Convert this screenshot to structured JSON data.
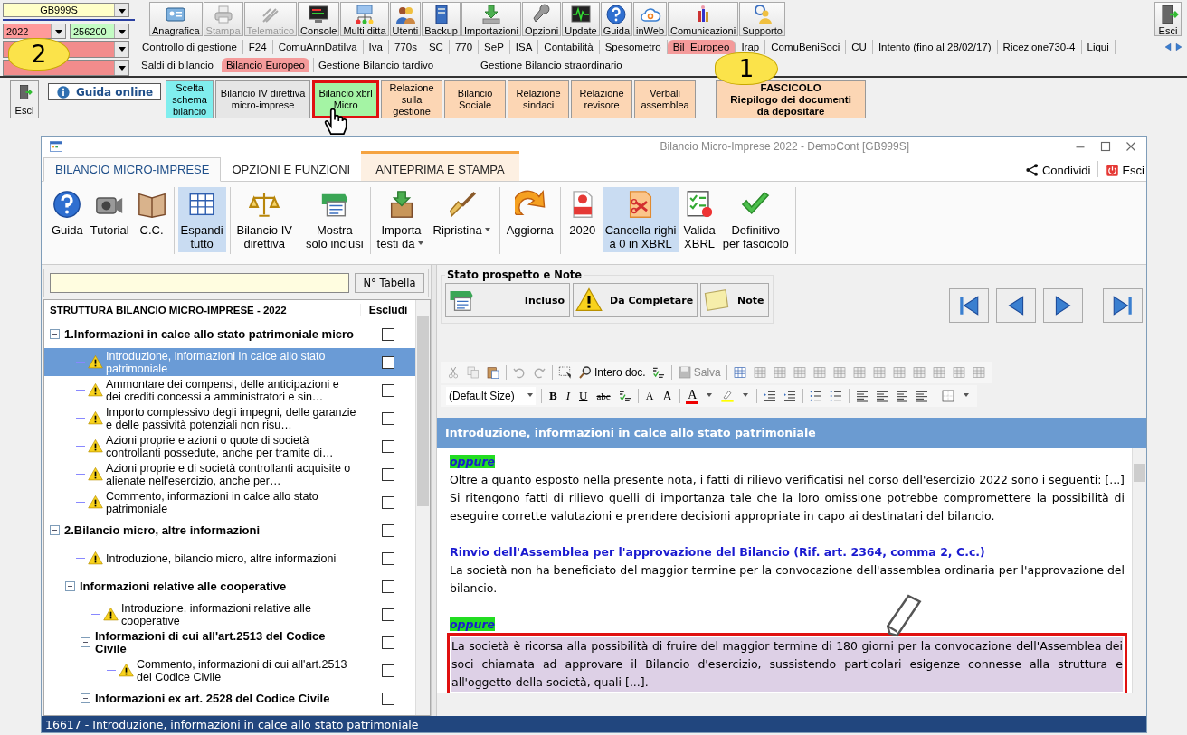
{
  "selectors": {
    "company": "GB999S",
    "year": "2022",
    "code": "256200 -"
  },
  "callouts": [
    {
      "label": "2"
    },
    {
      "label": "1"
    }
  ],
  "toolbar": [
    {
      "label": "Anagrafica",
      "disabled": false
    },
    {
      "label": "Stampa",
      "disabled": true
    },
    {
      "label": "Telematico",
      "disabled": true
    },
    {
      "label": "Console",
      "disabled": false
    },
    {
      "label": "Multi ditta",
      "disabled": false
    },
    {
      "label": "Utenti",
      "disabled": false
    },
    {
      "label": "Backup",
      "disabled": false
    },
    {
      "label": "Importazioni",
      "disabled": false
    },
    {
      "label": "Opzioni",
      "disabled": false
    },
    {
      "label": "Update",
      "disabled": false
    },
    {
      "label": "Guida",
      "disabled": false
    },
    {
      "label": "inWeb",
      "disabled": false
    },
    {
      "label": "Comunicazioni",
      "disabled": false
    },
    {
      "label": "Supporto",
      "disabled": false
    }
  ],
  "exit_button": "Esci",
  "module_tabs": [
    {
      "label": "Controllo di gestione",
      "selected": false
    },
    {
      "label": "F24",
      "selected": false
    },
    {
      "label": "ComuAnnDatiIva",
      "selected": false
    },
    {
      "label": "Iva",
      "selected": false
    },
    {
      "label": "770s",
      "selected": false
    },
    {
      "label": "SC",
      "selected": false
    },
    {
      "label": "770",
      "selected": false
    },
    {
      "label": "SeP",
      "selected": false
    },
    {
      "label": "ISA",
      "selected": false
    },
    {
      "label": "Contabilità",
      "selected": false
    },
    {
      "label": "Spesometro",
      "selected": false
    },
    {
      "label": "Bil_Europeo",
      "selected": true
    },
    {
      "label": "Irap",
      "selected": false
    },
    {
      "label": "ComuBeniSoci",
      "selected": false
    },
    {
      "label": "CU",
      "selected": false
    },
    {
      "label": "Intento (fino al 28/02/17)",
      "selected": false
    },
    {
      "label": "Ricezione730-4",
      "selected": false
    },
    {
      "label": "Liqui",
      "selected": false
    }
  ],
  "sub_tabs": [
    {
      "label": "Saldi di bilancio",
      "selected": false
    },
    {
      "label": "Bilancio Europeo",
      "selected": true
    },
    {
      "label": "Gestione Bilancio tardivo",
      "selected": false
    },
    {
      "label": "Gestione Bilancio straordinario",
      "selected": false
    }
  ],
  "launcher": {
    "exit": "Esci",
    "guide": "Guida online",
    "buttons": [
      {
        "label": "Scelta\nschema\nbilancio",
        "color": "#80eeee",
        "highlighted": false
      },
      {
        "label": "Bilancio IV direttiva\nmicro-imprese",
        "color": "#e6e6e6",
        "highlighted": false
      },
      {
        "label": "Bilancio xbrl\nMicro",
        "color": "#a4f4a4",
        "highlighted": true
      },
      {
        "label": "Relazione\nsulla\ngestione",
        "color": "#fcd6b4",
        "highlighted": false
      },
      {
        "label": "Bilancio\nSociale",
        "color": "#fcd6b4",
        "highlighted": false
      },
      {
        "label": "Relazione\nsindaci",
        "color": "#fcd6b4",
        "highlighted": false
      },
      {
        "label": "Relazione\nrevisore",
        "color": "#fcd6b4",
        "highlighted": false
      },
      {
        "label": "Verbali\nassemblea",
        "color": "#fcd6b4",
        "highlighted": false
      },
      {
        "label": "FASCICOLO\nRiepilogo dei documenti\nda depositare",
        "color": "#fcd6b4",
        "highlighted": false
      }
    ]
  },
  "window": {
    "title": "Bilancio Micro-Imprese 2022 - DemoCont [GB999S]",
    "tabs": [
      {
        "label": "BILANCIO MICRO-IMPRESE",
        "selected": true,
        "kind": "normal"
      },
      {
        "label": "OPZIONI E FUNZIONI",
        "selected": false,
        "kind": "normal"
      },
      {
        "label": "ANTEPRIMA E STAMPA",
        "selected": false,
        "kind": "contextual"
      }
    ],
    "share": "Condividi",
    "exit": "Esci",
    "ribbon": [
      [
        {
          "label": "Guida",
          "active": false
        },
        {
          "label": "Tutorial",
          "active": false
        },
        {
          "label": "C.C.",
          "active": false
        }
      ],
      [
        {
          "label": "Espandi\ntutto",
          "active": true
        }
      ],
      [
        {
          "label": "Bilancio IV\ndirettiva",
          "active": false
        }
      ],
      [
        {
          "label": "Mostra\nsolo inclusi",
          "active": false
        }
      ],
      [
        {
          "label": "Importa\ntesti da",
          "active": false,
          "dropdown": true
        },
        {
          "label": "Ripristina",
          "active": false,
          "dropdown": true
        }
      ],
      [
        {
          "label": "Aggiorna",
          "active": false
        }
      ],
      [
        {
          "label": "2020",
          "active": false
        },
        {
          "label": "Cancella righi\na 0 in XBRL",
          "active": true
        },
        {
          "label": "Valida\nXBRL",
          "active": false
        },
        {
          "label": "Definitivo\nper fascicolo",
          "active": false
        }
      ]
    ]
  },
  "left_pane": {
    "table_button": "N° Tabella",
    "title": "STRUTTURA BILANCIO MICRO-IMPRESE - 2022",
    "exclude_column": "Escludi",
    "tree": [
      {
        "label": "1.Informazioni in calce allo stato patrimoniale micro",
        "kind": "group",
        "expanded": true,
        "selected": false,
        "excluded": false,
        "children": [
          {
            "label": "Introduzione, informazioni in calce allo stato patrimoniale",
            "kind": "item",
            "selected": true,
            "excluded": false
          },
          {
            "label": "Ammontare dei compensi, delle anticipazioni e dei crediti concessi a amministratori e sin…",
            "kind": "item",
            "selected": false,
            "excluded": false
          },
          {
            "label": "Importo complessivo degli impegni, delle garanzie e delle passività potenziali non risu…",
            "kind": "item",
            "selected": false,
            "excluded": false
          },
          {
            "label": "Azioni proprie e azioni o quote di società controllanti possedute, anche per tramite di…",
            "kind": "item",
            "selected": false,
            "excluded": false
          },
          {
            "label": "Azioni proprie e di società controllanti acquisite o alienate nell'esercizio, anche per…",
            "kind": "item",
            "selected": false,
            "excluded": false
          },
          {
            "label": "Commento, informazioni in calce allo stato patrimoniale",
            "kind": "item",
            "selected": false,
            "excluded": false
          }
        ]
      },
      {
        "label": "2.Bilancio micro, altre informazioni",
        "kind": "group",
        "expanded": true,
        "selected": false,
        "excluded": false,
        "children": [
          {
            "label": "Introduzione, bilancio micro, altre informazioni",
            "kind": "item",
            "selected": false,
            "excluded": false
          },
          {
            "label": "Informazioni relative alle cooperative",
            "kind": "group",
            "expanded": true,
            "selected": false,
            "excluded": false,
            "children": [
              {
                "label": "Introduzione,  informazioni relative alle cooperative",
                "kind": "item",
                "selected": false,
                "excluded": false
              },
              {
                "label": "Informazioni di cui all'art.2513 del Codice Civile",
                "kind": "group",
                "expanded": true,
                "selected": false,
                "excluded": false,
                "children": [
                  {
                    "label": "Commento, informazioni di cui all'art.2513 del Codice Civile",
                    "kind": "item",
                    "selected": false,
                    "excluded": false
                  }
                ]
              },
              {
                "label": "Informazioni ex art. 2528 del Codice Civile",
                "kind": "group",
                "expanded": true,
                "selected": false,
                "excluded": false
              }
            ]
          }
        ]
      }
    ]
  },
  "right_pane": {
    "status_group": "Stato prospetto e Note",
    "status_buttons": [
      {
        "label": "Incluso",
        "kind": "included"
      },
      {
        "label": "Da Completare",
        "kind": "warning"
      },
      {
        "label": "Note",
        "kind": "note"
      }
    ],
    "editor": {
      "find_label": "Intero doc.",
      "save": {
        "label": "Salva",
        "disabled": true
      },
      "font_size": "(Default Size)",
      "format_buttons": [
        "B",
        "I",
        "U",
        "abc"
      ],
      "size_buttons": [
        "A",
        "A"
      ],
      "color_button": "A"
    },
    "heading": "Introduzione, informazioni in calce allo stato patrimoniale",
    "blocks": [
      {
        "kind": "tag",
        "text": "oppure"
      },
      {
        "kind": "paragraph",
        "text": "Oltre a quanto esposto nella presente nota, i fatti di rilievo verificatisi nel corso dell'esercizio 2022 sono i seguenti: [...] Si ritengono fatti di rilievo quelli di importanza tale che la loro omissione potrebbe compromettere la possibilità di eseguire corrette valutazioni e prendere decisioni appropriate in capo ai destinatari del bilancio.",
        "highlighted": false
      },
      {
        "kind": "heading",
        "text": "Rinvio dell'Assemblea per l'approvazione del Bilancio (Rif. art. 2364, comma 2, C.c.)"
      },
      {
        "kind": "paragraph",
        "text": "La società non ha beneficiato del maggior termine per la convocazione dell'assemblea ordinaria per l'approvazione del bilancio.",
        "highlighted": false
      },
      {
        "kind": "tag",
        "text": "oppure"
      },
      {
        "kind": "paragraph",
        "text": "La società è ricorsa alla possibilità di fruire del maggior termine di 180 giorni per la convocazione dell'Assemblea dei soci chiamata ad approvare il Bilancio d'esercizio, sussistendo particolari esigenze connesse alla struttura e all'oggetto della società, quali [...].",
        "highlighted": true
      }
    ]
  },
  "status_bar": "16617 - Introduzione, informazioni in calce allo stato patrimoniale"
}
